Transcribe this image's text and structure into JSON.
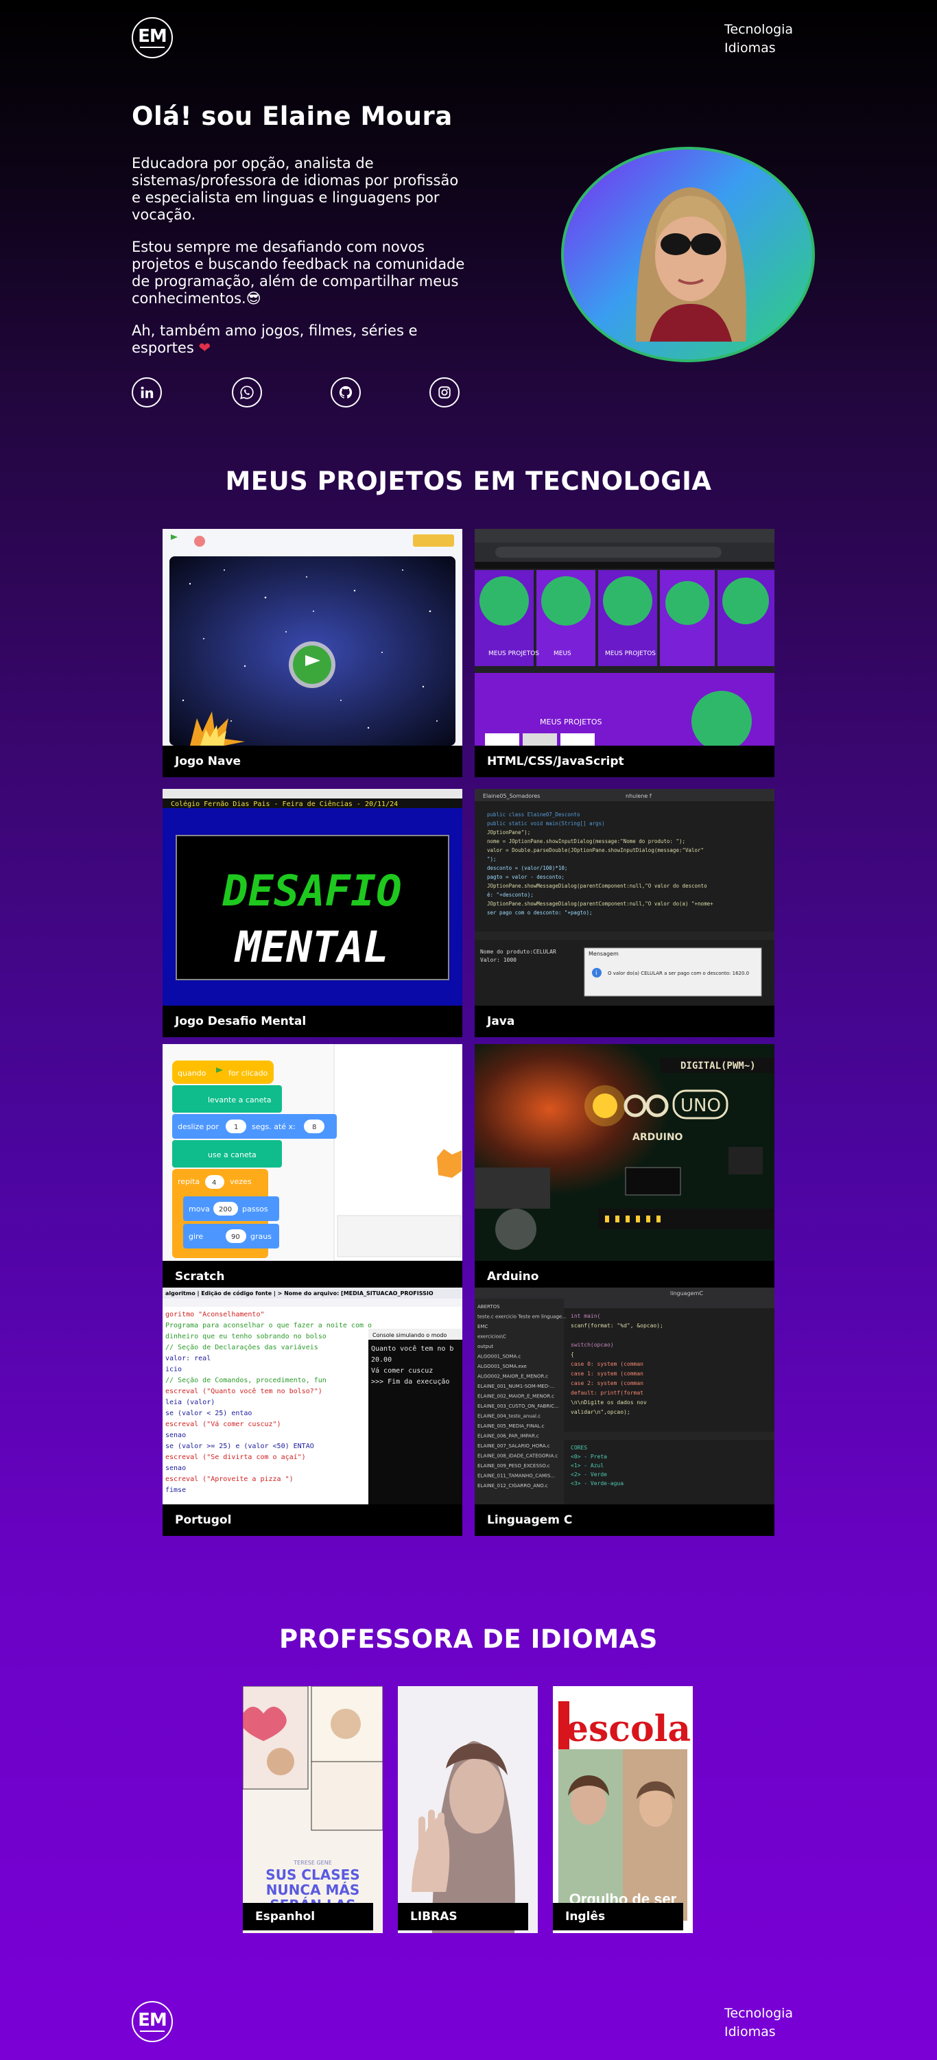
{
  "header": {
    "logo_text": "EM",
    "nav": [
      {
        "label": "Tecnologia"
      },
      {
        "label": "Idiomas"
      }
    ]
  },
  "hero": {
    "title": "Olá! sou Elaine Moura",
    "paragraph_1": "Educadora por opção, analista de sistemas/professora de idiomas por profissão e especialista em linguas e linguagens por vocação.",
    "paragraph_2": "Estou sempre me desafiando com novos projetos e buscando feedback na comunidade de programação, além de compartilhar meus conhecimentos.",
    "paragraph_2_emoji": "😎",
    "paragraph_3": "Ah, também amo jogos, filmes, séries e esportes",
    "paragraph_3_emoji": "❤",
    "socials": [
      {
        "icon": "linkedin-icon"
      },
      {
        "icon": "whatsapp-icon"
      },
      {
        "icon": "github-icon"
      },
      {
        "icon": "instagram-icon"
      }
    ]
  },
  "projects": {
    "title": "MEUS PROJETOS EM TECNOLOGIA",
    "items": [
      {
        "label": "Jogo Nave"
      },
      {
        "label": "HTML/CSS/JavaScript"
      },
      {
        "label": "Jogo Desafio Mental"
      },
      {
        "label": "Java"
      },
      {
        "label": "Scratch"
      },
      {
        "label": "Arduino"
      },
      {
        "label": "Portugol"
      },
      {
        "label": "Linguagem C"
      }
    ],
    "thumb_text": {
      "desafio_header": "Colégio Fernão Dias Pais - Feira de Ciências - 20/11/24",
      "desafio_line1": "DESAFIO",
      "desafio_line2": "MENTAL",
      "html_caption_1": "MEUS PROJETOS",
      "html_caption_2": "MEUS",
      "html_caption_3": "MEUS PROJETOS",
      "html_caption_4": "MEUS PROJETOS",
      "scratch_blocks": [
        "quando",
        "for clicado",
        "levante a caneta",
        "deslize por",
        "1",
        "segs. até x:",
        "8",
        "use a caneta",
        "repita",
        "4",
        "vezes",
        "mova",
        "200",
        "passos",
        "gire",
        "90",
        "graus"
      ],
      "arduino_text": "ARDUINO",
      "arduino_uno": "UNO",
      "arduino_digital": "DIGITAL(PWM~)",
      "portugol_header": "algoritmo | Edição de código fonte | > Nome do arquivo: [MEDIA_SITUACAO_PROFISSIO",
      "portugol_lines": [
        "goritmo \"Aconselhamento\"",
        "Programa para aconselhar o que fazer a noite com o",
        "dinheiro que eu tenho sobrando no bolso",
        "// Seção de Declarações das variáveis",
        "valor: real",
        "icio",
        "// Seção de Comandos, procedimento, fun",
        "escreval (\"Quanto você tem no bolso?\")",
        "leia (valor)",
        "se (valor < 25) entao",
        "   escreval (\"Vá comer cuscuz\")",
        "senao",
        "   se (valor >= 25) e (valor <50) ENTAO",
        "      escreval (\"Se divirta com o açaí\")",
        "   senao",
        "      escreval (\"Aproveite a pizza \")",
        "   fimse"
      ],
      "portugol_console_title": "Console simulando o modo",
      "portugol_console": [
        "Quanto você tem no b",
        "20.00",
        "Vá comer cuscuz",
        ">>> Fim da execução"
      ],
      "java_tab_1": "Elaine05_Somadores",
      "java_tab_2": "nhuiene f",
      "java_lines": [
        "public class Elaine07_Desconto",
        "   public static void main(String[] args)",
        "   JOptionPane\");",
        "   nome = JOptionPane.showInputDialog(message:\"Nome do produto: \");",
        "      valor = Double.parseDouble(JOptionPane.showInputDialog(message:\"Valor\"",
        "      \");",
        "   desconto = (valor/100)*10;",
        "      pagto = valor - desconto;",
        "      JOptionPane.showMessageDialog(parentComponent:null,\"O valor do desconto",
        "      é: \"+desconto);",
        "   JOptionPane.showMessageDialog(parentComponent:null,\"O valor do(a) \"+nome+",
        "   ser pago com o desconto: \"+pagto);"
      ],
      "java_console": [
        "Nome do produto:CELULAR",
        "Valor: 1000"
      ],
      "java_dialog_title": "Mensagem",
      "java_dialog_text": "O valor do(a) CELULAR a ser pago com o desconto: 1620.0",
      "c_search": "linguagemC",
      "c_files": [
        "ABERTOS",
        "teste.c  exercicio Teste em linguage...",
        "EMC",
        "exercicios\\C",
        "output",
        "ALGO001_SOMA.c",
        "ALGO001_SOMA.exe",
        "ALGO002_MAIOR_E_MENOR.c",
        "ELAINE_001_NUM1-SOM-MED-...",
        "ELAINE_002_MAIOR_E_MENOR.c",
        "ELAINE_003_CUSTO_ON_FABRIC...",
        "ELAINE_004_teste_anual.c",
        "ELAINE_005_MEDIA_FINAL.c",
        "ELAINE_006_PAR_IMPAR.c",
        "ELAINE_007_SALARIO_HORA.c",
        "ELAINE_008_IDADE_CATEGORIA.c",
        "ELAINE_009_PESO_EXCESSO.c",
        "ELAINE_011_TAMANHO_CAMIS...",
        "ELAINE_012_CIGARRO_ANO.c"
      ],
      "c_code": [
        "int main(",
        "   scanf(format: \"%d\", &opcao);",
        "",
        "   switch(opcao)",
        "   {",
        "      case 0: system (comman",
        "      case 1: system (comman",
        "      case 2: system (comman",
        "      default: printf(format",
        "      \\n\\nDigite os dados nov",
        "      validar\\n\",opcao);"
      ],
      "c_terminal": [
        "CORES",
        "<0> - Preta",
        "<1> - Azul",
        "<2> - Verde",
        "<3> - Verde-agua"
      ]
    }
  },
  "languages": {
    "title": "PROFESSORA DE IDIOMAS",
    "items": [
      {
        "label": "Espanhol"
      },
      {
        "label": "LIBRAS"
      },
      {
        "label": "Inglês"
      }
    ],
    "espanhol_poster": [
      "SUS CLASES",
      "NUNCA MÁS",
      "SERÁN LAS"
    ],
    "escola_title": "escola",
    "escola_caption": "Orgulho de ser"
  },
  "footer": {
    "logo_text": "EM",
    "nav": [
      {
        "label": "Tecnologia"
      },
      {
        "label": "Idiomas"
      }
    ]
  },
  "colors": {
    "accent_green": "#2fb86a",
    "heart": "#e0314b",
    "background_end": "#7a00d6"
  }
}
